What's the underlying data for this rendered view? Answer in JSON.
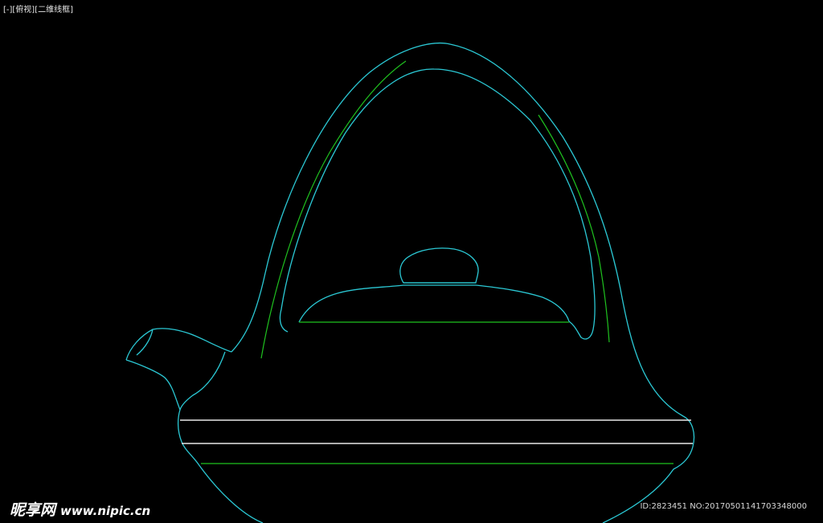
{
  "viewport": {
    "label": "[-][俯视][二维线框]"
  },
  "colors": {
    "background": "#000000",
    "outline": "#2bc8d4",
    "inner_line": "#1fc21f",
    "band": "#e8e8e8"
  },
  "watermark": {
    "logo_text": "昵享网",
    "url": "www.nipic.cn",
    "id_text": "ID:2823451 NO:20170501141703348000"
  }
}
